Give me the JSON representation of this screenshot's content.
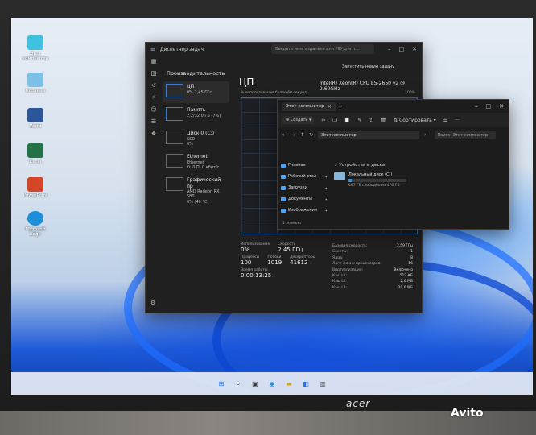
{
  "desktop_icons": [
    {
      "label": "Этот компьютер",
      "color": "#3fc2e0"
    },
    {
      "label": "Корзина",
      "color": "#7cc0e8"
    },
    {
      "label": "Word",
      "color": "#2b579a"
    },
    {
      "label": "Excel",
      "color": "#217346"
    },
    {
      "label": "PowerPoint",
      "color": "#d24726"
    },
    {
      "label": "Microsoft Edge",
      "color": "#1d8fd8"
    }
  ],
  "task_manager": {
    "window_title": "Диспетчер задач",
    "search_placeholder": "Введите имя, издателя или PID для п...",
    "section_heading": "Производительность",
    "run_task": "Запустить новую задачу",
    "items": [
      {
        "name": "ЦП",
        "line1": "0% 2,45 ГГц",
        "line2": ""
      },
      {
        "name": "Память",
        "line1": "2,2/32,0 ГБ (7%)",
        "line2": ""
      },
      {
        "name": "Диск 0 (C:)",
        "line1": "SSD",
        "line2": "0%"
      },
      {
        "name": "Ethernet",
        "line1": "Ethernet",
        "line2": "О: 0 П: 0 кбит/с"
      },
      {
        "name": "Графический пр",
        "line1": "AMD Radeon RX 580",
        "line2": "0% (40 °C)"
      }
    ],
    "main_title": "ЦП",
    "cpu_name": "Intel(R) Xeon(R) CPU E5-2650 v2 @ 2.60GHz",
    "graph_label": "% использования более 60 секунд",
    "graph_max": "100%",
    "stats": {
      "usage_label": "Использование",
      "usage": "0%",
      "speed_label": "Скорость",
      "speed": "2,45 ГГц",
      "processes_label": "Процессы",
      "processes": "100",
      "threads_label": "Потоки",
      "threads": "1019",
      "handles_label": "Дескрипторы",
      "handles": "41612",
      "uptime_label": "Время работы",
      "uptime": "0:00:13:25"
    },
    "right_stats": [
      {
        "label": "Базовая скорость:",
        "value": "2,59 ГГц"
      },
      {
        "label": "Сокеты:",
        "value": "1"
      },
      {
        "label": "Ядра:",
        "value": "8"
      },
      {
        "label": "Логических процессоров:",
        "value": "16"
      },
      {
        "label": "Виртуализация:",
        "value": "Включено"
      },
      {
        "label": "Кэш L1:",
        "value": "512 КБ"
      },
      {
        "label": "Кэш L2:",
        "value": "2,0 МБ"
      },
      {
        "label": "Кэш L3:",
        "value": "20,0 МБ"
      }
    ]
  },
  "explorer": {
    "tab_title": "Этот компьютер",
    "create_label": "Создать",
    "sort_label": "Сортировать",
    "address": "Этот компьютер",
    "search_placeholder": "Поиск: Этот компьютер",
    "sidebar": [
      {
        "label": "Главная"
      },
      {
        "label": "Рабочий стол"
      },
      {
        "label": "Загрузки"
      },
      {
        "label": "Документы"
      },
      {
        "label": "Изображения"
      }
    ],
    "group": "Устройства и диски",
    "drive_name": "Локальный диск (C:)",
    "drive_free": "447 ГБ свободно из 476 ГБ",
    "drive_used_fraction": 0.06,
    "item_count": "1 элемент"
  },
  "monitor_brand": "acer",
  "watermark": "Avito"
}
